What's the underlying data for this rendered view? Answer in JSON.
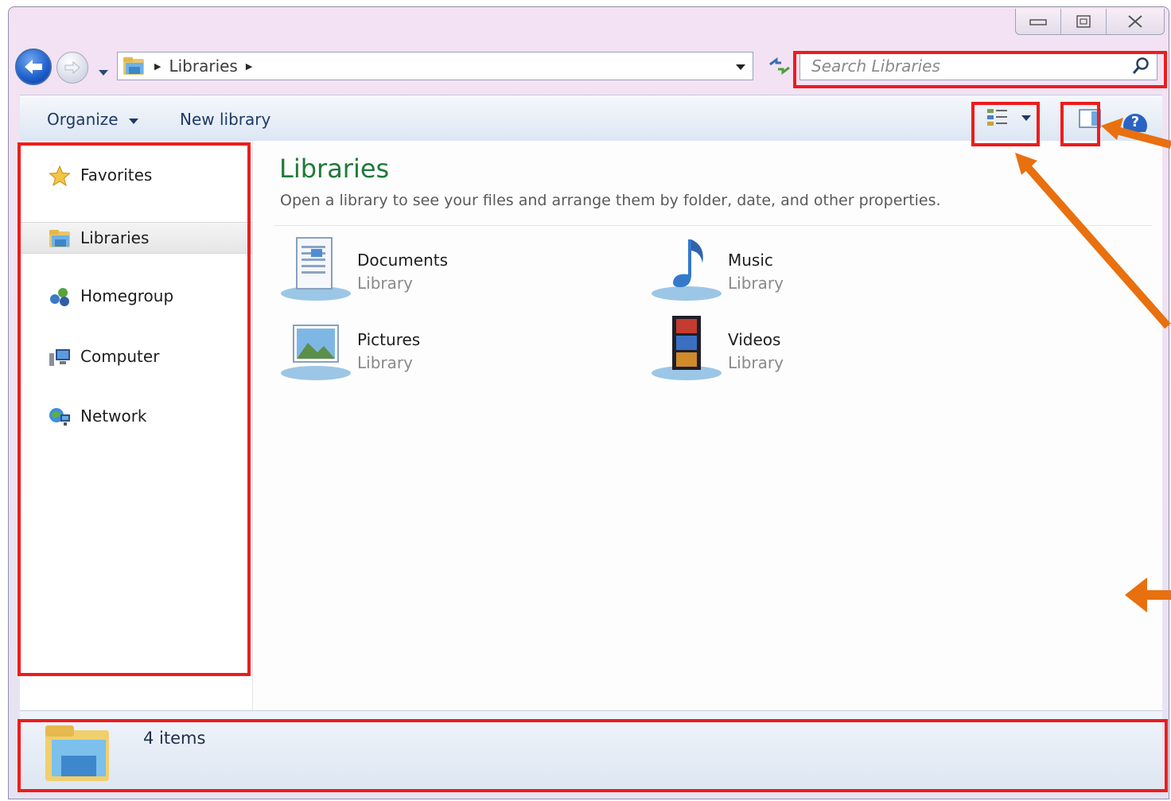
{
  "window": {
    "caption_buttons": [
      "minimize",
      "maximize",
      "close"
    ]
  },
  "address_bar": {
    "breadcrumb": "Libraries"
  },
  "search": {
    "placeholder": "Search Libraries"
  },
  "toolbar": {
    "organize_label": "Organize",
    "new_library_label": "New library"
  },
  "nav_pane": {
    "items": [
      {
        "label": "Favorites",
        "icon": "star-icon"
      },
      {
        "label": "Libraries",
        "icon": "libraries-icon",
        "selected": true
      },
      {
        "label": "Homegroup",
        "icon": "homegroup-icon"
      },
      {
        "label": "Computer",
        "icon": "computer-icon"
      },
      {
        "label": "Network",
        "icon": "network-icon"
      }
    ]
  },
  "content": {
    "title": "Libraries",
    "description": "Open a library to see your files and arrange them by folder, date, and other properties.",
    "libraries": [
      {
        "name": "Documents",
        "type": "Library",
        "icon": "documents-library-icon"
      },
      {
        "name": "Music",
        "type": "Library",
        "icon": "music-library-icon"
      },
      {
        "name": "Pictures",
        "type": "Library",
        "icon": "pictures-library-icon"
      },
      {
        "name": "Videos",
        "type": "Library",
        "icon": "videos-library-icon"
      }
    ]
  },
  "status_bar": {
    "item_count": "4 items"
  },
  "colors": {
    "title_green": "#1e7a3a",
    "highlight_red": "#ee1c1c",
    "arrow_orange": "#e8700f",
    "command_text": "#1e3a66"
  }
}
